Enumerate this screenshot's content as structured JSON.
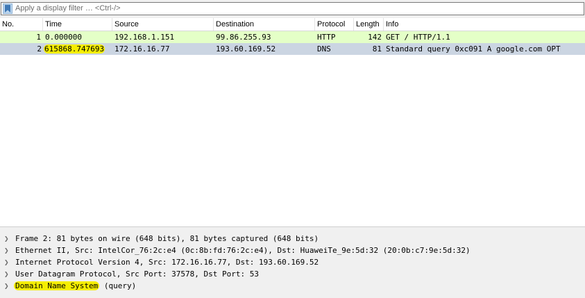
{
  "filter": {
    "placeholder": "Apply a display filter … <Ctrl-/>",
    "icon": "bookmark-icon"
  },
  "columns": [
    "No.",
    "Time",
    "Source",
    "Destination",
    "Protocol",
    "Length",
    "Info"
  ],
  "packets": [
    {
      "no": "1",
      "time": "0.000000",
      "source": "192.168.1.151",
      "destination": "99.86.255.93",
      "protocol": "HTTP",
      "length": "142",
      "info": "GET / HTTP/1.1",
      "bg": "#e4ffc7",
      "selected": false
    },
    {
      "no": "2",
      "time": "615868.747693",
      "source": "172.16.16.77",
      "destination": "193.60.169.52",
      "protocol": "DNS",
      "length": "81",
      "info": "Standard query 0xc091 A google.com OPT",
      "bg": "#cbd5e2",
      "selected": true
    }
  ],
  "details": [
    {
      "text": "Frame 2: 81 bytes on wire (648 bits), 81 bytes captured (648 bits)"
    },
    {
      "text": "Ethernet II, Src: IntelCor_76:2c:e4 (0c:8b:fd:76:2c:e4), Dst: HuaweiTe_9e:5d:32 (20:0b:c7:9e:5d:32)"
    },
    {
      "text": "Internet Protocol Version 4, Src: 172.16.16.77, Dst: 193.60.169.52"
    },
    {
      "text": "User Datagram Protocol, Src Port: 37578, Dst Port: 53"
    },
    {
      "highlight": "Domain Name System",
      "rest": " (query)"
    }
  ],
  "colors": {
    "highlight": "#f5ee00",
    "http_row": "#e4ffc7",
    "selected_row": "#cbd5e2",
    "pane_bg": "#f0f0f0"
  }
}
